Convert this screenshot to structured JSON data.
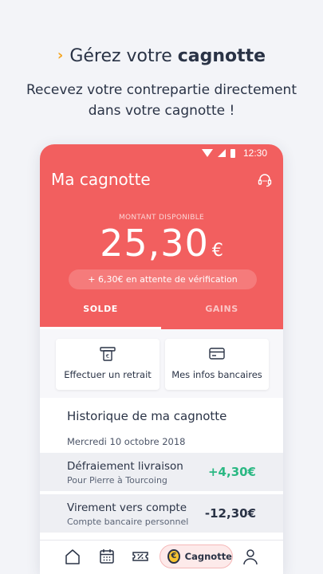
{
  "hero": {
    "title_prefix": "Gérez votre ",
    "title_bold": "cagnotte",
    "subtitle": "Recevez votre contrepartie directement dans votre cagnotte !"
  },
  "status_bar": {
    "time": "12:30"
  },
  "app": {
    "title": "Ma cagnotte"
  },
  "balance": {
    "label": "MONTANT DISPONIBLE",
    "amount": "25,30",
    "currency": "€",
    "pending": "+ 6,30€ en attente de vérification"
  },
  "tabs": [
    {
      "label": "SOLDE",
      "active": true
    },
    {
      "label": "GAINS",
      "active": false
    }
  ],
  "actions": [
    {
      "label": "Effectuer un retrait",
      "icon": "atm-withdraw-icon"
    },
    {
      "label": "Mes infos bancaires",
      "icon": "bank-card-icon"
    }
  ],
  "history": {
    "title": "Historique de ma cagnotte",
    "date": "Mercredi 10 octobre 2018",
    "items": [
      {
        "title": "Défraiement livraison",
        "subtitle": "Pour Pierre à Tourcoing",
        "value": "+4,30€",
        "type": "credit"
      },
      {
        "title": "Virement vers compte",
        "subtitle": "Compte bancaire personnel",
        "value": "-12,30€",
        "type": "debit"
      }
    ]
  },
  "nav": {
    "items": [
      "home-icon",
      "calendar-icon",
      "ticket-icon",
      "cagnotte",
      "profile-icon"
    ],
    "active_label": "Cagnotte",
    "coin_symbol": "€"
  },
  "colors": {
    "brand_red": "#f25f5f",
    "positive": "#2bb883",
    "accent_chevron": "#f5a623",
    "text_dark": "#2a3346"
  }
}
